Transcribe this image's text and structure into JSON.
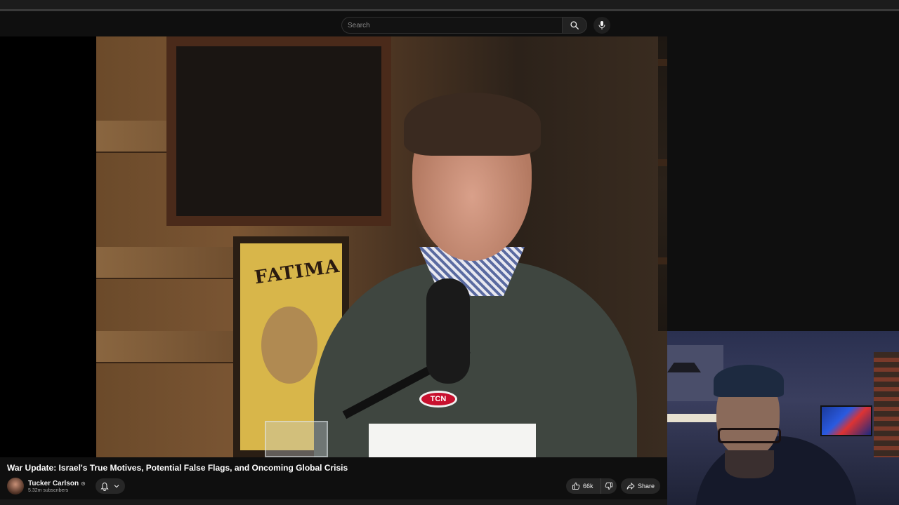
{
  "search": {
    "placeholder": "Search"
  },
  "icons": {
    "search": "search-icon",
    "mic": "microphone-icon",
    "bell": "bell-icon",
    "chevron": "chevron-down-icon",
    "like": "thumbs-up-icon",
    "dislike": "thumbs-down-icon",
    "share": "share-icon",
    "verified": "verified-check-icon"
  },
  "video": {
    "title": "War Update: Israel's True Motives, Potential False Flags, and Oncoming Global Crisis",
    "poster_text": "FATIMA",
    "mic_badge": "TCN"
  },
  "channel": {
    "name": "Tucker Carlson",
    "verified_mark": "⊙",
    "subscribers": "5.32m subscribers"
  },
  "actions": {
    "likes": "66k",
    "share_label": "Share"
  },
  "colors": {
    "background": "#0f0f0f",
    "pill": "#272727",
    "text": "#f1f1f1",
    "muted": "#aaaaaa"
  }
}
